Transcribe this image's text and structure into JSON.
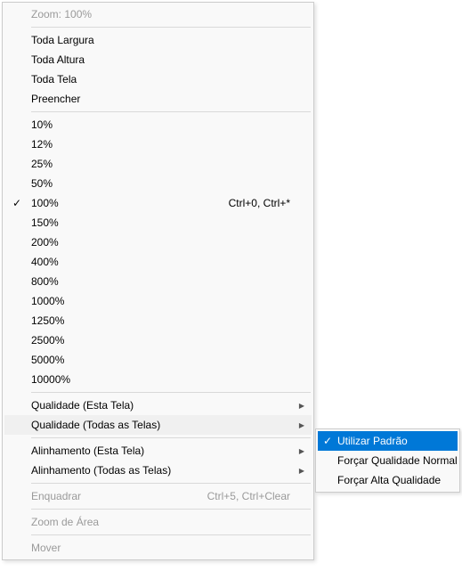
{
  "menu": {
    "header": "Zoom: 100%",
    "fitItems": [
      {
        "label": "Toda Largura"
      },
      {
        "label": "Toda Altura"
      },
      {
        "label": "Toda Tela"
      },
      {
        "label": "Preencher"
      }
    ],
    "zoomLevels": [
      {
        "label": "10%"
      },
      {
        "label": "12%"
      },
      {
        "label": "25%"
      },
      {
        "label": "50%"
      },
      {
        "label": "100%",
        "checked": true,
        "accel": "Ctrl+0, Ctrl+*"
      },
      {
        "label": "150%"
      },
      {
        "label": "200%"
      },
      {
        "label": "400%"
      },
      {
        "label": "800%"
      },
      {
        "label": "1000%"
      },
      {
        "label": "1250%"
      },
      {
        "label": "2500%"
      },
      {
        "label": "5000%"
      },
      {
        "label": "10000%"
      }
    ],
    "qualityItems": [
      {
        "label": "Qualidade (Esta Tela)",
        "hasSubmenu": true
      },
      {
        "label": "Qualidade (Todas as Telas)",
        "hasSubmenu": true,
        "hovered": true
      }
    ],
    "alignmentItems": [
      {
        "label": "Alinhamento (Esta Tela)",
        "hasSubmenu": true
      },
      {
        "label": "Alinhamento (Todas as Telas)",
        "hasSubmenu": true
      }
    ],
    "bottomItems": [
      {
        "label": "Enquadrar",
        "accel": "Ctrl+5, Ctrl+Clear",
        "disabled": true
      },
      {
        "sep": true
      },
      {
        "label": "Zoom de Área",
        "disabled": true
      },
      {
        "sep": true
      },
      {
        "label": "Mover",
        "disabled": true
      }
    ]
  },
  "submenu": {
    "items": [
      {
        "label": "Utilizar Padrão",
        "checked": true,
        "selected": true
      },
      {
        "label": "Forçar Qualidade Normal"
      },
      {
        "label": "Forçar Alta Qualidade"
      }
    ]
  }
}
